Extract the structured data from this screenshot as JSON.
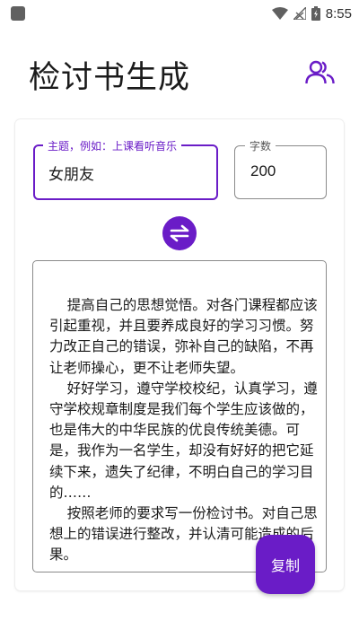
{
  "status_bar": {
    "time": "8:55",
    "icons": [
      "app-notification-icon",
      "wifi-icon",
      "signal-icon",
      "battery-icon"
    ]
  },
  "header": {
    "title": "检讨书生成",
    "action_icon": "people-icon"
  },
  "form": {
    "topic": {
      "label": "主题，例如：上课看听音乐",
      "value": "女朋友"
    },
    "word_count": {
      "label": "字数",
      "value": "200"
    },
    "swap_icon": "swap-arrows-icon"
  },
  "output": {
    "text": "    提高自己的思想觉悟。对各门课程都应该引起重视，并且要养成良好的学习习惯。努力改正自己的错误，弥补自己的缺陷，不再让老师操心，更不让老师失望。\n    好好学习，遵守学校校纪，认真学习，遵守学校规章制度是我们每个学生应该做的，也是伟大的中华民族的优良传统美德。可是，我作为一名学生，却没有好好的把它延续下来，遗失了纪律，不明白自己的学习目的……\n    按照老师的要求写一份检讨书。对自己思想上的错误进行整改，并认清可能造成的后果。"
  },
  "copy_button": {
    "label": "复制"
  },
  "colors": {
    "accent": "#6a1cc7",
    "border": "#8a8a8a",
    "status_icons": "#606060"
  }
}
